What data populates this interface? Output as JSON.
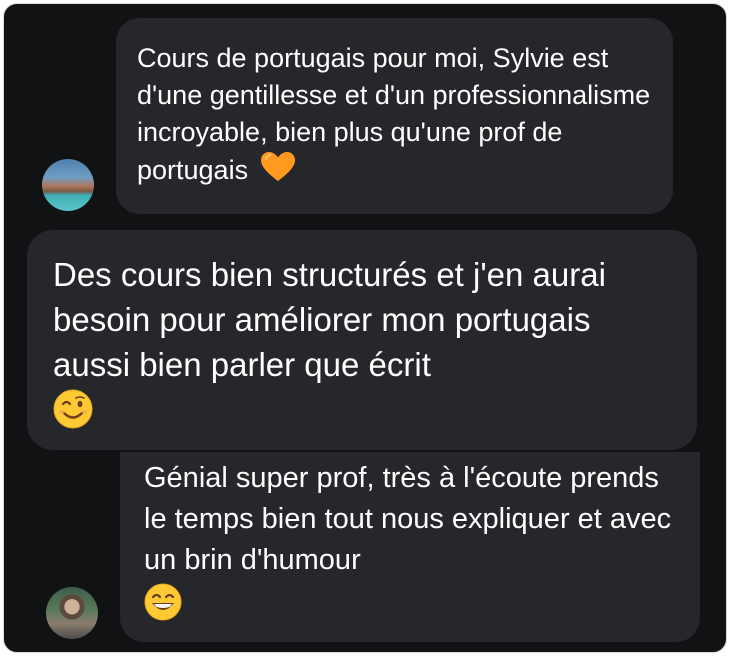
{
  "messages": [
    {
      "text": "Cours de portugais pour moi, Sylvie est d'une gentillesse et d'un professionnalisme incroyable, bien plus qu'une prof de portugais",
      "emoji": "orange-heart-icon",
      "has_avatar": true
    },
    {
      "text": "Des cours bien structurés et j'en aurai besoin pour améliorer mon portugais aussi bien parler que écrit",
      "emoji": "winking-face-icon",
      "has_avatar": false
    },
    {
      "text": "Génial super prof, très à l'écoute prends le temps bien tout nous expliquer et avec un brin d'humour",
      "emoji": "grinning-face-icon",
      "has_avatar": true
    }
  ],
  "colors": {
    "background": "#111214",
    "bubble": "#26272b",
    "text": "#ffffff",
    "heart": "#ff9a1f",
    "emoji_face": "#ffc933"
  }
}
